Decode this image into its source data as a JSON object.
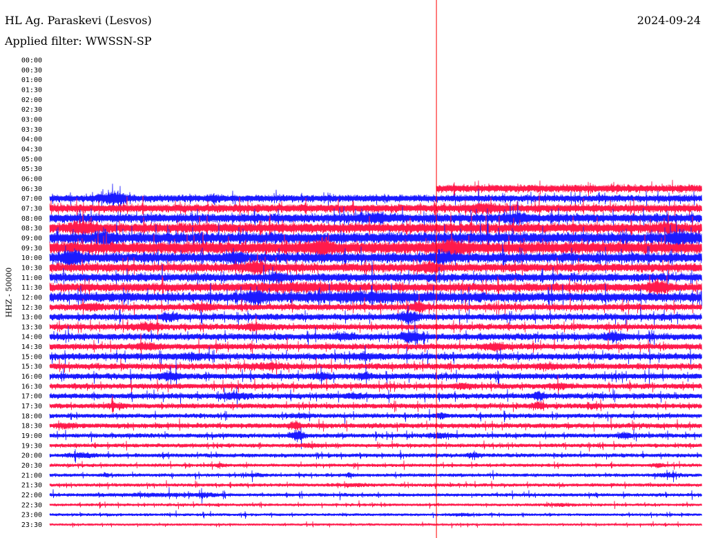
{
  "header": {
    "station": "HL Ag. Paraskevi (Lesvos)",
    "date": "2024-09-24",
    "filter": "Applied filter: WWSSN-SP"
  },
  "chart_data": {
    "type": "line",
    "title": "HL Ag. Paraskevi (Lesvos)",
    "subtitle": "Applied filter: WWSSN-SP",
    "date": "2024-09-24",
    "ylabel": "HHZ - 50000",
    "xlabel": "",
    "grid": false,
    "row_labels": [
      "00:00",
      "00:30",
      "01:00",
      "01:30",
      "02:00",
      "02:30",
      "03:00",
      "03:30",
      "04:00",
      "04:30",
      "05:00",
      "05:30",
      "06:00",
      "06:30",
      "07:00",
      "07:30",
      "08:00",
      "08:30",
      "09:00",
      "09:30",
      "10:00",
      "10:30",
      "11:00",
      "11:30",
      "12:00",
      "12:30",
      "13:00",
      "13:30",
      "14:00",
      "14:30",
      "15:00",
      "15:30",
      "16:00",
      "16:30",
      "17:00",
      "17:30",
      "18:00",
      "18:30",
      "19:00",
      "19:30",
      "20:00",
      "20:30",
      "21:00",
      "21:30",
      "22:00",
      "22:30",
      "23:00",
      "23:30"
    ],
    "x_range": [
      0,
      30
    ],
    "x_units": "minutes",
    "marker_minute": 17.8,
    "colors": {
      "red": "#ff1a4b",
      "blue": "#1a1aff",
      "marker": "#ff0000"
    },
    "series": [
      {
        "row": "06:30",
        "start_minute": 17.8,
        "color": "red",
        "amplitude": 0.7,
        "events": []
      },
      {
        "row": "07:00",
        "start_minute": 0,
        "color": "blue",
        "amplitude": 0.65,
        "events": [
          [
            3.0,
            0.4,
            2.2
          ],
          [
            7.5,
            0.2,
            1.5
          ]
        ]
      },
      {
        "row": "07:30",
        "start_minute": 0,
        "color": "red",
        "amplitude": 0.75,
        "events": [
          [
            20.0,
            0.5,
            1.6
          ]
        ]
      },
      {
        "row": "08:00",
        "start_minute": 0,
        "color": "blue",
        "amplitude": 0.8,
        "events": [
          [
            15.0,
            0.5,
            1.6
          ],
          [
            21.5,
            0.4,
            1.7
          ]
        ]
      },
      {
        "row": "08:30",
        "start_minute": 0,
        "color": "red",
        "amplitude": 0.9,
        "events": [
          [
            1.5,
            0.4,
            1.8
          ],
          [
            28.5,
            0.4,
            1.6
          ]
        ]
      },
      {
        "row": "09:00",
        "start_minute": 0,
        "color": "blue",
        "amplitude": 1.0,
        "events": [
          [
            2.5,
            0.3,
            1.7
          ],
          [
            29.0,
            0.4,
            1.6
          ]
        ]
      },
      {
        "row": "09:30",
        "start_minute": 0,
        "color": "red",
        "amplitude": 1.1,
        "events": [
          [
            12.5,
            0.4,
            1.7
          ],
          [
            18.5,
            0.5,
            1.6
          ]
        ]
      },
      {
        "row": "10:00",
        "start_minute": 0,
        "color": "blue",
        "amplitude": 0.9,
        "events": [
          [
            1.0,
            0.3,
            2.2
          ],
          [
            8.5,
            0.3,
            1.7
          ],
          [
            18.0,
            0.3,
            1.6
          ]
        ]
      },
      {
        "row": "10:30",
        "start_minute": 0,
        "color": "red",
        "amplitude": 0.8,
        "events": [
          [
            9.5,
            0.3,
            2.0
          ],
          [
            17.5,
            0.3,
            1.7
          ]
        ]
      },
      {
        "row": "11:00",
        "start_minute": 0,
        "color": "blue",
        "amplitude": 0.75,
        "events": [
          [
            10.5,
            0.2,
            1.8
          ]
        ]
      },
      {
        "row": "11:30",
        "start_minute": 0,
        "color": "red",
        "amplitude": 0.8,
        "events": [
          [
            11.5,
            1.5,
            1.4
          ],
          [
            28.0,
            0.3,
            2.0
          ]
        ]
      },
      {
        "row": "12:00",
        "start_minute": 0,
        "color": "blue",
        "amplitude": 0.85,
        "events": [
          [
            9.5,
            0.3,
            2.0
          ],
          [
            14.5,
            2.5,
            1.4
          ]
        ]
      },
      {
        "row": "12:30",
        "start_minute": 0,
        "color": "red",
        "amplitude": 0.6,
        "events": [
          [
            2.0,
            0.3,
            1.8
          ],
          [
            7.0,
            0.3,
            1.6
          ],
          [
            17.0,
            0.2,
            2.2
          ]
        ]
      },
      {
        "row": "13:00",
        "start_minute": 0,
        "color": "blue",
        "amplitude": 0.6,
        "events": [
          [
            5.5,
            0.3,
            1.8
          ],
          [
            16.5,
            0.3,
            2.2
          ]
        ]
      },
      {
        "row": "13:30",
        "start_minute": 0,
        "color": "red",
        "amplitude": 0.55,
        "events": [
          [
            4.5,
            0.4,
            1.8
          ],
          [
            9.5,
            0.4,
            1.7
          ]
        ]
      },
      {
        "row": "14:00",
        "start_minute": 0,
        "color": "blue",
        "amplitude": 0.6,
        "events": [
          [
            16.6,
            0.3,
            2.3
          ],
          [
            26.0,
            0.3,
            2.0
          ],
          [
            13.5,
            0.4,
            1.5
          ]
        ]
      },
      {
        "row": "14:30",
        "start_minute": 0,
        "color": "red",
        "amplitude": 0.55,
        "events": [
          [
            4.5,
            0.4,
            1.6
          ],
          [
            20.5,
            0.3,
            1.9
          ]
        ]
      },
      {
        "row": "15:00",
        "start_minute": 0,
        "color": "blue",
        "amplitude": 0.6,
        "events": [
          [
            6.5,
            0.5,
            1.5
          ],
          [
            14.5,
            0.5,
            1.4
          ]
        ]
      },
      {
        "row": "15:30",
        "start_minute": 0,
        "color": "red",
        "amplitude": 0.55,
        "events": [
          [
            10.0,
            0.5,
            1.5
          ],
          [
            23.0,
            0.4,
            1.5
          ]
        ]
      },
      {
        "row": "16:00",
        "start_minute": 0,
        "color": "blue",
        "amplitude": 0.55,
        "events": [
          [
            5.5,
            0.3,
            2.0
          ],
          [
            12.5,
            0.3,
            1.6
          ],
          [
            14.5,
            0.2,
            1.7
          ]
        ]
      },
      {
        "row": "16:30",
        "start_minute": 0,
        "color": "red",
        "amplitude": 0.5,
        "events": [
          [
            19.0,
            0.3,
            1.6
          ],
          [
            23.5,
            0.3,
            1.5
          ]
        ]
      },
      {
        "row": "17:00",
        "start_minute": 0,
        "color": "blue",
        "amplitude": 0.5,
        "events": [
          [
            8.5,
            0.4,
            1.8
          ],
          [
            14.0,
            0.3,
            1.6
          ],
          [
            22.5,
            0.2,
            2.0
          ]
        ]
      },
      {
        "row": "17:30",
        "start_minute": 0,
        "color": "red",
        "amplitude": 0.45,
        "events": [
          [
            3.0,
            0.3,
            1.6
          ],
          [
            22.5,
            0.2,
            2.0
          ],
          [
            25.0,
            0.2,
            1.7
          ]
        ]
      },
      {
        "row": "18:00",
        "start_minute": 0,
        "color": "blue",
        "amplitude": 0.4,
        "events": [
          [
            11.5,
            0.3,
            1.6
          ],
          [
            18.0,
            0.2,
            1.8
          ]
        ]
      },
      {
        "row": "18:30",
        "start_minute": 0,
        "color": "red",
        "amplitude": 0.45,
        "events": [
          [
            0.8,
            0.3,
            1.5
          ],
          [
            11.3,
            0.2,
            2.2
          ]
        ]
      },
      {
        "row": "19:00",
        "start_minute": 0,
        "color": "blue",
        "amplitude": 0.4,
        "events": [
          [
            11.4,
            0.2,
            3.0
          ],
          [
            18.0,
            0.4,
            1.6
          ],
          [
            26.5,
            0.2,
            2.0
          ]
        ]
      },
      {
        "row": "19:30",
        "start_minute": 0,
        "color": "red",
        "amplitude": 0.35,
        "events": [
          [
            12.0,
            0.5,
            1.5
          ]
        ]
      },
      {
        "row": "20:00",
        "start_minute": 0,
        "color": "blue",
        "amplitude": 0.35,
        "events": [
          [
            1.5,
            0.4,
            1.8
          ],
          [
            19.5,
            0.2,
            1.8
          ]
        ]
      },
      {
        "row": "20:30",
        "start_minute": 0,
        "color": "red",
        "amplitude": 0.3,
        "events": [
          [
            7.8,
            0.2,
            1.6
          ],
          [
            28.0,
            0.2,
            1.8
          ]
        ]
      },
      {
        "row": "21:00",
        "start_minute": 0,
        "color": "blue",
        "amplitude": 0.3,
        "events": [
          [
            2.6,
            0.1,
            2.0
          ],
          [
            9.5,
            0.3,
            1.5
          ],
          [
            13.8,
            0.1,
            2.2
          ],
          [
            28.5,
            0.4,
            1.8
          ]
        ]
      },
      {
        "row": "21:30",
        "start_minute": 0,
        "color": "red",
        "amplitude": 0.3,
        "events": [
          [
            14.0,
            0.4,
            1.6
          ]
        ]
      },
      {
        "row": "22:00",
        "start_minute": 0,
        "color": "blue",
        "amplitude": 0.3,
        "events": [
          [
            4.8,
            1.3,
            1.5
          ],
          [
            7.2,
            0.4,
            1.8
          ]
        ]
      },
      {
        "row": "22:30",
        "start_minute": 0,
        "color": "red",
        "amplitude": 0.25,
        "events": [
          [
            23.5,
            0.4,
            1.6
          ]
        ]
      },
      {
        "row": "23:00",
        "start_minute": 0,
        "color": "blue",
        "amplitude": 0.25,
        "events": [
          [
            19.0,
            0.3,
            1.6
          ]
        ]
      },
      {
        "row": "23:30",
        "start_minute": 0,
        "color": "red",
        "amplitude": 0.2,
        "events": []
      }
    ]
  }
}
